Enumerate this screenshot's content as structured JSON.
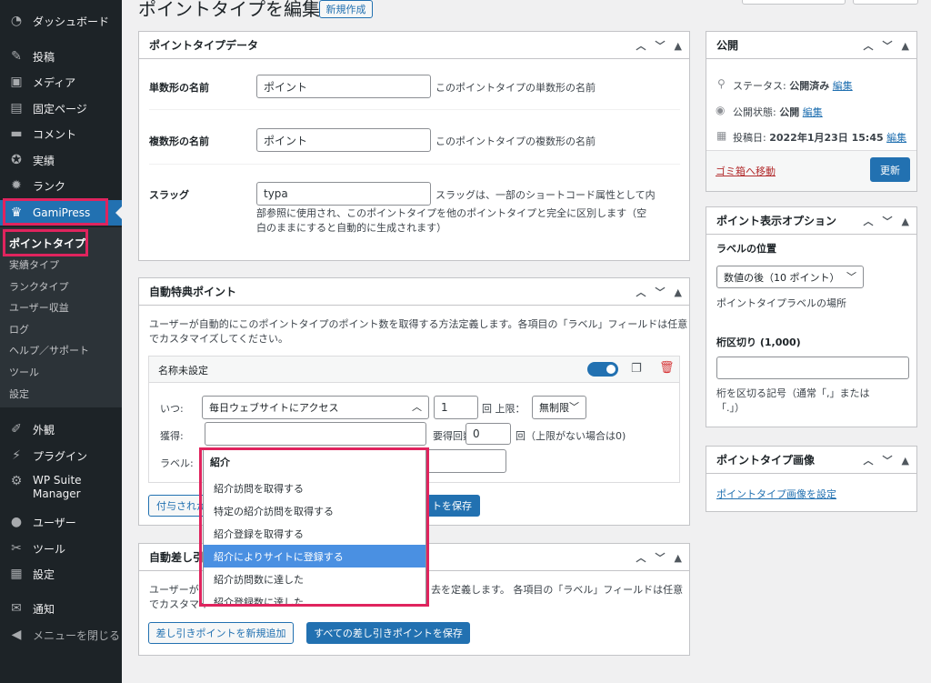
{
  "colors": {
    "accent": "#2271b1",
    "highlight": "#e0245e",
    "sidebar": "#1d2327",
    "danger": "#d63638"
  },
  "sidebar": {
    "items": [
      {
        "label": "ダッシュボード",
        "icon": "dashboard-icon"
      },
      {
        "label": "投稿",
        "icon": "pin-icon"
      },
      {
        "label": "メディア",
        "icon": "media-icon"
      },
      {
        "label": "固定ページ",
        "icon": "page-icon"
      },
      {
        "label": "コメント",
        "icon": "comment-icon"
      },
      {
        "label": "実績",
        "icon": "award-icon"
      },
      {
        "label": "ランク",
        "icon": "rank-icon"
      },
      {
        "label": "GamiPress",
        "icon": "crown-icon"
      },
      {
        "label": "外観",
        "icon": "appearance-icon"
      },
      {
        "label": "プラグイン",
        "icon": "plugin-icon"
      },
      {
        "label": "WP Suite Manager",
        "icon": "gear-icon"
      },
      {
        "label": "ユーザー",
        "icon": "user-icon"
      },
      {
        "label": "ツール",
        "icon": "wrench-icon"
      },
      {
        "label": "設定",
        "icon": "settings-icon"
      },
      {
        "label": "通知",
        "icon": "mail-icon"
      },
      {
        "label": "メニューを閉じる",
        "icon": "collapse-icon"
      }
    ],
    "submenu": [
      "ポイントタイプ",
      "実績タイプ",
      "ランクタイプ",
      "ユーザー収益",
      "ログ",
      "ヘルプ／サポート",
      "ツール",
      "設定"
    ]
  },
  "header": {
    "title": "ポイントタイプを編集",
    "new_button": "新規作成"
  },
  "pt_data": {
    "title": "ポイントタイプデータ",
    "singular_label": "単数形の名前",
    "singular_value": "ポイント",
    "singular_help": "このポイントタイプの単数形の名前",
    "plural_label": "複数形の名前",
    "plural_value": "ポイント",
    "plural_help": "このポイントタイプの複数形の名前",
    "slug_label": "スラッグ",
    "slug_value": "typa",
    "slug_help_1": "スラッグは、一部のショートコード属性として内",
    "slug_help_2": "部参照に使用され、このポイントタイプを他のポイントタイプと完全に区別します（空",
    "slug_help_3": "白のままにすると自動的に生成されます）"
  },
  "auto_award": {
    "title": "自動特典ポイント",
    "desc_1": "ユーザーが自動的にこのポイントタイプのポイント数を取得する方法定義します。各項目の「ラベル」フィールドは任意",
    "desc_2": "でカスタマイズしてください。",
    "item_title": "名称未設定",
    "when_label": "いつ:",
    "when_value": "毎日ウェブサイトにアクセス",
    "count_value": "1",
    "limit_label": "回 上限：",
    "limit_value": "無制限",
    "earn_label": "獲得:",
    "required_times_label": "要得回数",
    "required_times_value": "0",
    "required_times_help": "回（上限がない場合は0)",
    "label_label": "ラベル:",
    "add_button_partial": "付与されか",
    "save_button_partial": "トを保存"
  },
  "dropdown": {
    "group": "紹介",
    "options": [
      "紹介訪問を取得する",
      "特定の紹介訪問を取得する",
      "紹介登録を取得する",
      "紹介によりサイトに登録する",
      "紹介訪問数に達した",
      "紹介登録数に達した"
    ],
    "selected_index": 3
  },
  "auto_deduct": {
    "title_partial": "自動差し引",
    "desc_1_left": "ユーザーが",
    "desc_1_right": "去を定義します。 各項目の「ラベル」フィールドは任意",
    "desc_2_left": "でカスタマイ",
    "add_button": "差し引きポイントを新規追加",
    "save_button": "すべての差し引きポイントを保存"
  },
  "publish": {
    "title": "公開",
    "status_label": "ステータス:",
    "status_value": "公開済み",
    "status_edit": "編集",
    "visibility_label": "公開状態:",
    "visibility_value": "公開",
    "visibility_edit": "編集",
    "date_label": "投稿日:",
    "date_value": "2022年1月23日 15:45",
    "date_edit": "編集",
    "trash_link": "ゴミ箱へ移動",
    "update_button": "更新"
  },
  "display_options": {
    "title": "ポイント表示オプション",
    "label_position_label": "ラベルの位置",
    "label_position_value": "数値の後（10 ポイント）",
    "label_position_help": "ポイントタイプラベルの場所",
    "separator_label": "桁区切り (1,000)",
    "separator_value": "",
    "separator_help_1": "桁を区切る記号（通常「,」または",
    "separator_help_2": "「.」）"
  },
  "type_image": {
    "title": "ポイントタイプ画像",
    "link": "ポイントタイプ画像を設定"
  }
}
